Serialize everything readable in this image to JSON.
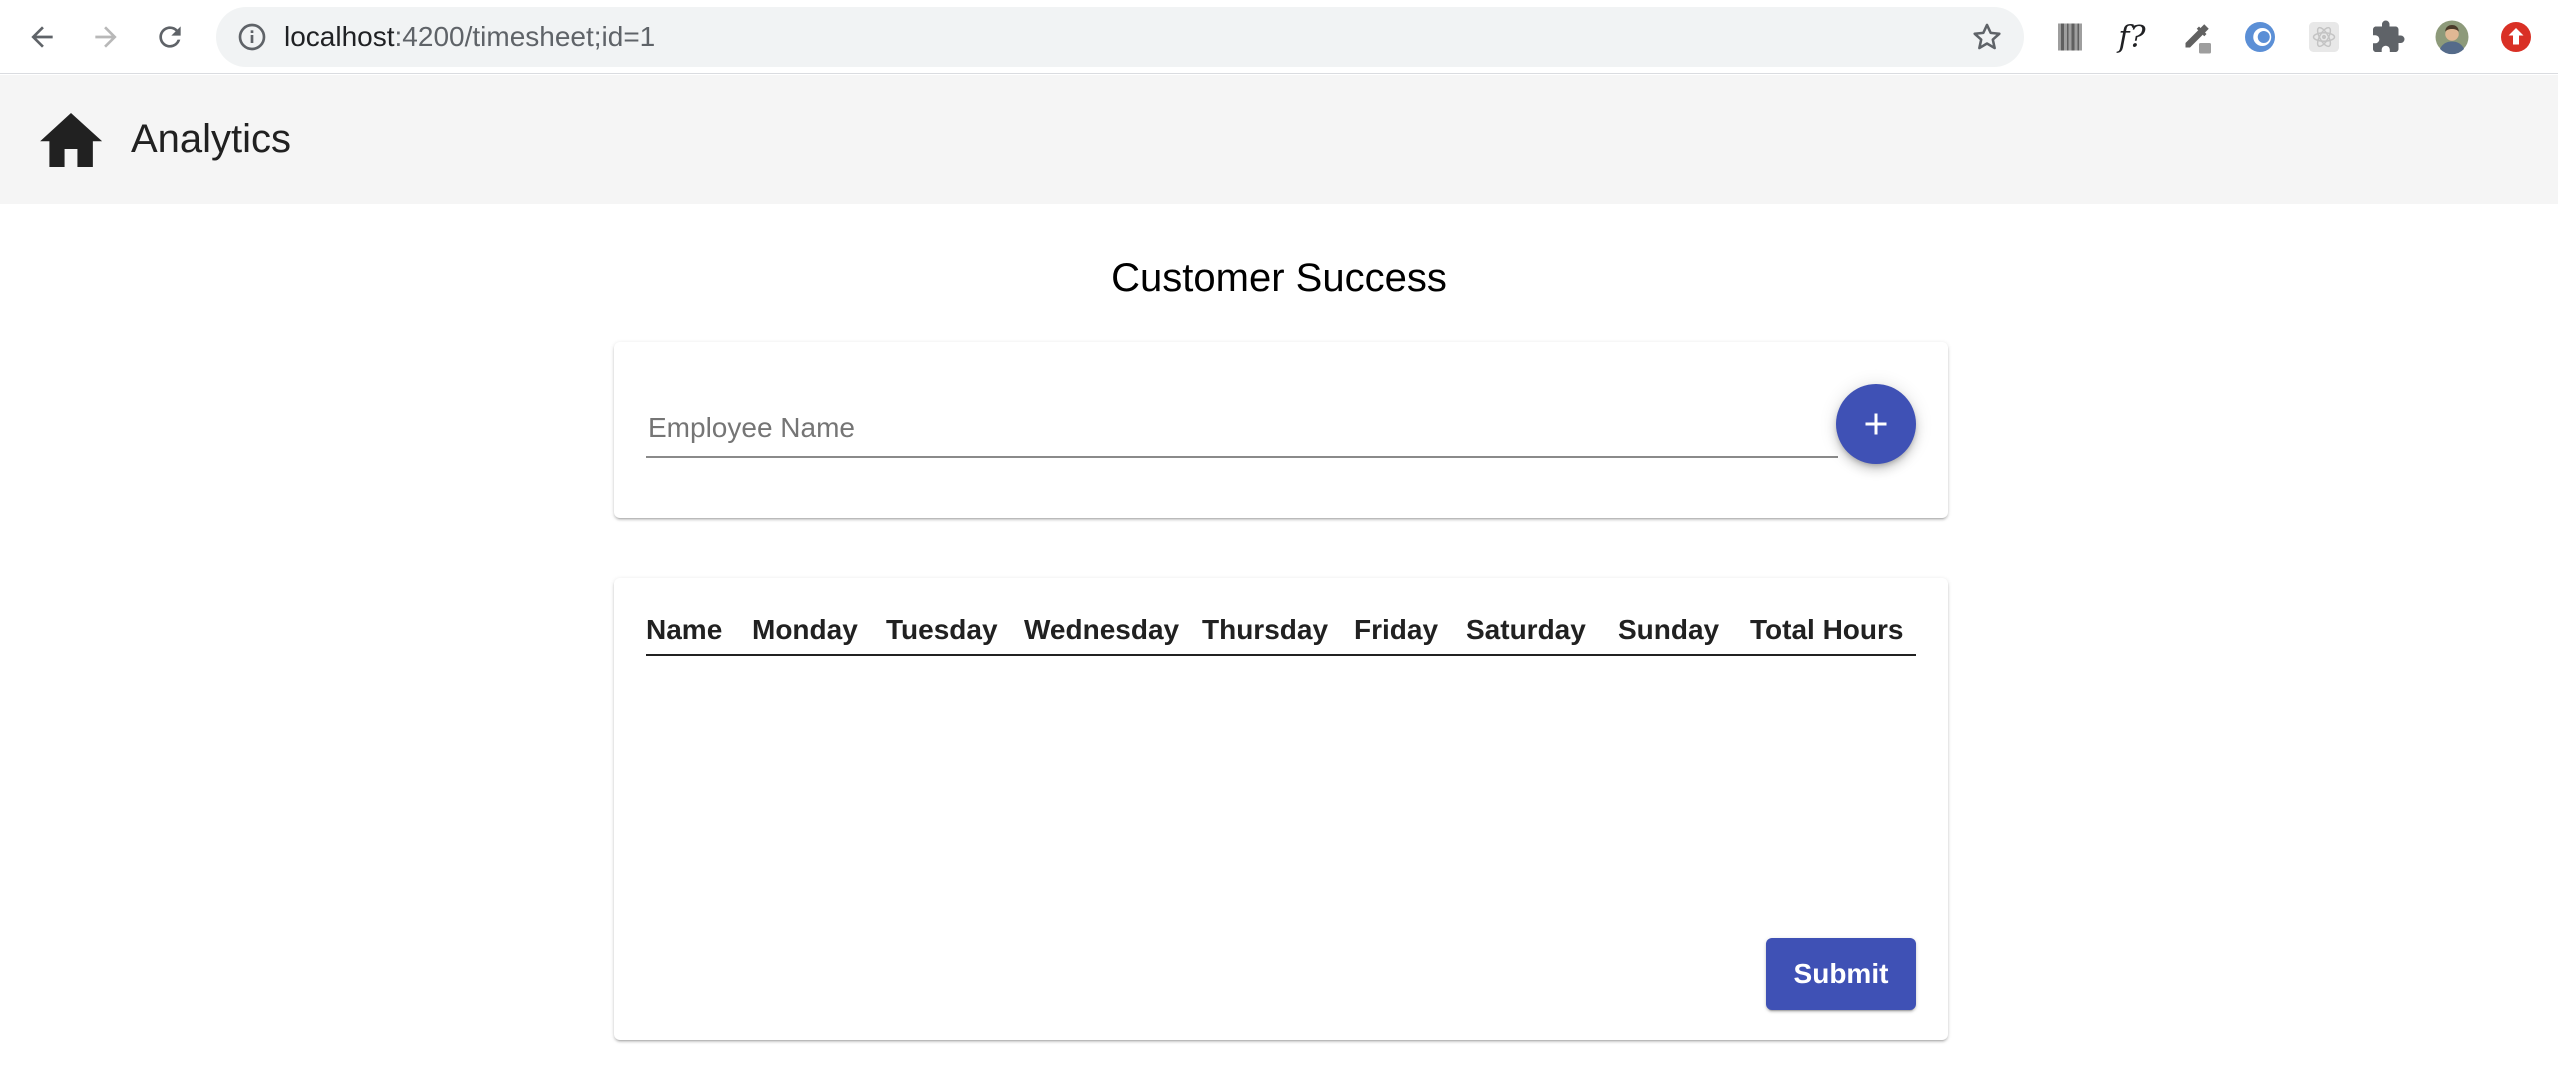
{
  "browser": {
    "url_host": "localhost",
    "url_path": ":4200/timesheet;id=1",
    "extensions": {
      "formula_label": "f?"
    },
    "icons": [
      "back-arrow-icon",
      "forward-arrow-icon",
      "reload-icon",
      "info-icon",
      "star-icon",
      "barcode-icon",
      "color-picker-icon",
      "vpn-icon",
      "react-devtools-icon",
      "extensions-puzzle-icon",
      "profile-avatar",
      "update-icon"
    ]
  },
  "toolbar": {
    "title": "Analytics",
    "icon": "home-icon"
  },
  "page": {
    "title": "Customer Success"
  },
  "form": {
    "employee_placeholder": "Employee Name",
    "employee_value": "",
    "add_icon": "plus-icon"
  },
  "table": {
    "columns": [
      "Name",
      "Monday",
      "Tuesday",
      "Wednesday",
      "Thursday",
      "Friday",
      "Saturday",
      "Sunday",
      "Total Hours"
    ],
    "rows": []
  },
  "actions": {
    "submit_label": "Submit"
  },
  "colors": {
    "primary": "#3f51b5",
    "toolbar_bg": "#f5f5f5",
    "update_badge": "#d93025"
  }
}
